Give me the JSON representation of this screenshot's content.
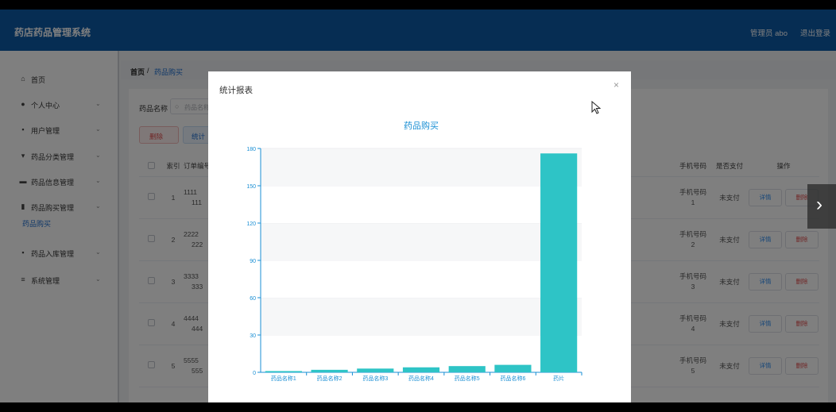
{
  "app": {
    "title": "药店药品管理系统",
    "admin": "管理员 abo",
    "logout": "退出登录"
  },
  "sidebar": {
    "items": [
      {
        "label": "首页",
        "icon": "home-icon",
        "glyph": "⌂",
        "expandable": false
      },
      {
        "label": "个人中心",
        "icon": "user-icon",
        "glyph": "●",
        "expandable": true
      },
      {
        "label": "用户管理",
        "icon": "grid-icon",
        "glyph": "▪",
        "expandable": true
      },
      {
        "label": "药品分类管理",
        "icon": "category-icon",
        "glyph": "▾",
        "expandable": true
      },
      {
        "label": "药品信息管理",
        "icon": "monitor-icon",
        "glyph": "▬",
        "expandable": true
      },
      {
        "label": "药品购买管理",
        "icon": "bar-chart-icon",
        "glyph": "▮",
        "expandable": true
      },
      {
        "label": "药品入库管理",
        "icon": "grid-icon",
        "glyph": "▪",
        "expandable": true
      },
      {
        "label": "系统管理",
        "icon": "menu-icon",
        "glyph": "≡",
        "expandable": true
      }
    ],
    "active_sub": "药品购买"
  },
  "breadcrumb": {
    "home": "首页",
    "sep": "/",
    "current": "药品购买"
  },
  "search": {
    "label": "药品名称",
    "placeholder": "药品名称"
  },
  "toolbar": {
    "delete": "删除",
    "delete_icon": "trash-icon",
    "stats": "统计",
    "stats_icon": "bar-chart-icon"
  },
  "table": {
    "headers": [
      "索引",
      "订单编号",
      "手机号码",
      "是否支付",
      "操作"
    ],
    "rows": [
      {
        "index": "1",
        "order": "1111",
        "order2": "111",
        "phone": "手机号码",
        "phone2": "1",
        "paid": "未支付"
      },
      {
        "index": "2",
        "order": "2222",
        "order2": "222",
        "phone": "手机号码",
        "phone2": "2",
        "paid": "未支付"
      },
      {
        "index": "3",
        "order": "3333",
        "order2": "333",
        "phone": "手机号码",
        "phone2": "3",
        "paid": "未支付"
      },
      {
        "index": "4",
        "order": "4444",
        "order2": "444",
        "phone": "手机号码",
        "phone2": "4",
        "paid": "未支付"
      },
      {
        "index": "5",
        "order": "5555",
        "order2": "555",
        "phone": "手机号码",
        "phone2": "5",
        "paid": "未支付"
      }
    ],
    "detail_label": "详情",
    "delete_label": "删除"
  },
  "dialog": {
    "title": "统计报表",
    "close": "×"
  },
  "chart_data": {
    "type": "bar",
    "title": "药品购买",
    "categories": [
      "药品名称1",
      "药品名称2",
      "药品名称3",
      "药品名称4",
      "药品名称5",
      "药品名称6",
      "药片"
    ],
    "values": [
      1,
      2,
      3,
      4,
      5,
      6,
      176
    ],
    "ylim": [
      0,
      180
    ],
    "yticks": [
      0,
      30,
      60,
      90,
      120,
      150,
      180
    ],
    "bar_color": "#2ec4c6",
    "axis_color": "#1a8fd4",
    "grid": true
  },
  "nav": {
    "next_icon": "chevron-right-icon",
    "next_glyph": "›"
  }
}
